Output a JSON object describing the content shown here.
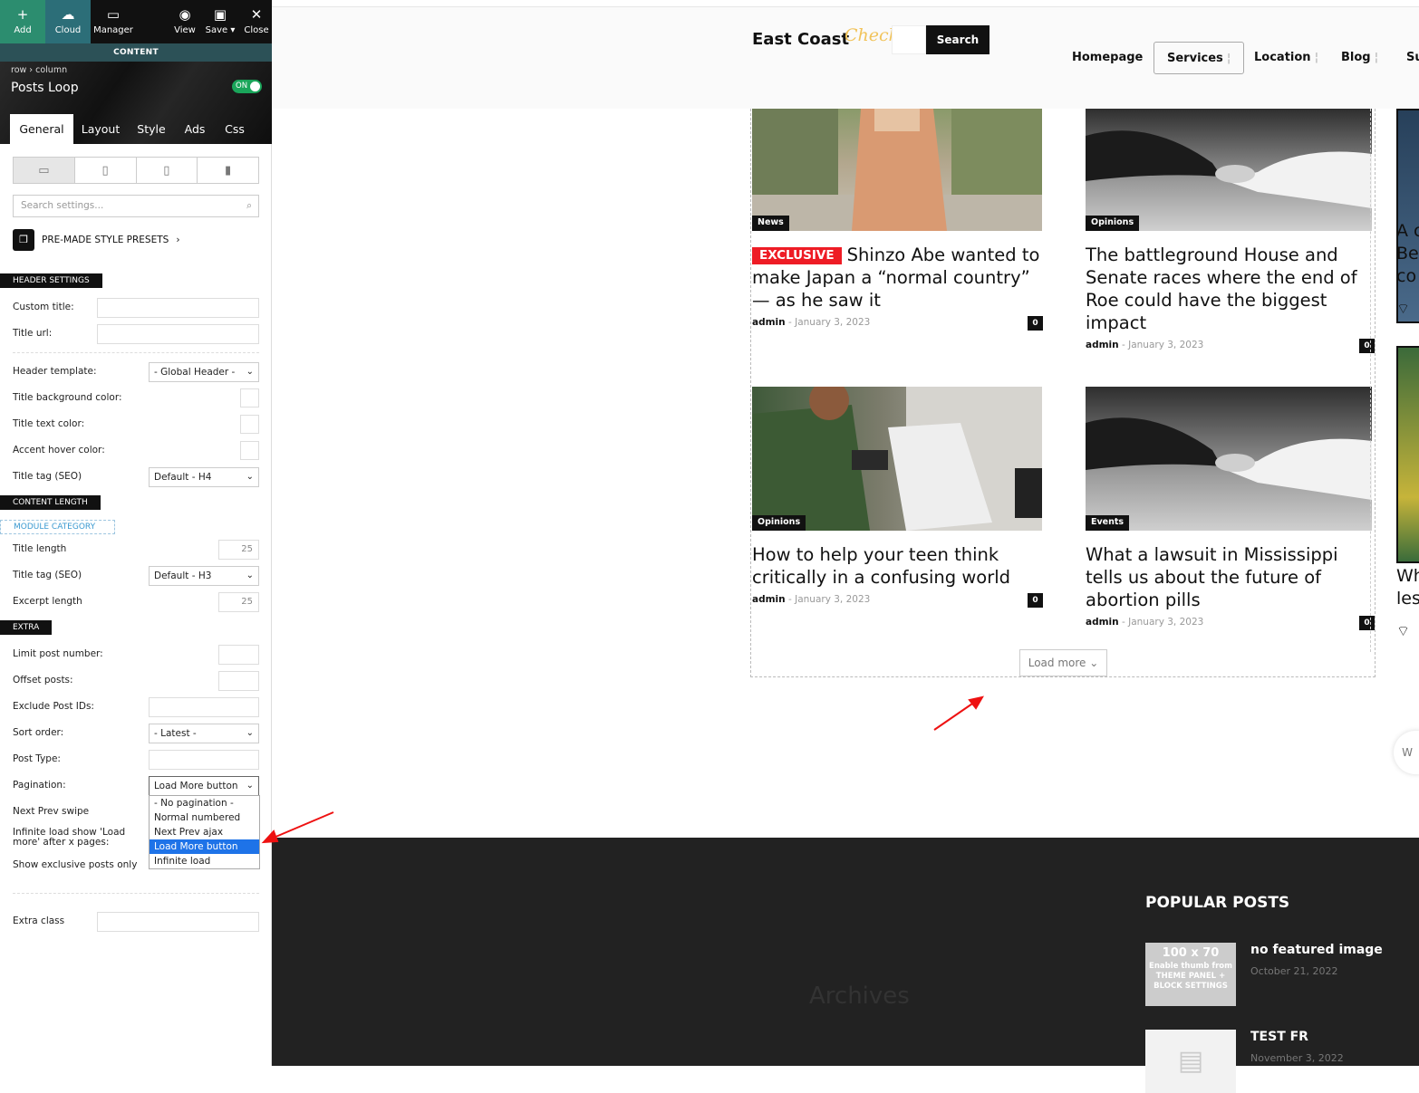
{
  "toolbar": {
    "add": "Add",
    "cloud": "Cloud",
    "manager": "Manager",
    "view": "View",
    "save": "Save",
    "close": "Close",
    "content_label": "CONTENT"
  },
  "panel": {
    "breadcrumb": "row › column",
    "title": "Posts Loop",
    "toggle": "ON",
    "tabs": [
      "General",
      "Layout",
      "Style",
      "Ads",
      "Css"
    ],
    "search_placeholder": "Search settings...",
    "presets": "PRE-MADE STYLE PRESETS",
    "sections": {
      "header": "HEADER SETTINGS",
      "content_length": "CONTENT LENGTH",
      "module_category": "MODULE CATEGORY",
      "extra": "EXTRA"
    },
    "labels": {
      "custom_title": "Custom title:",
      "title_url": "Title url:",
      "header_template": "Header template:",
      "title_bg": "Title background color:",
      "title_text": "Title text color:",
      "accent_hover": "Accent hover color:",
      "title_tag_h4": "Title tag (SEO)",
      "title_length": "Title length",
      "title_tag_h3": "Title tag (SEO)",
      "excerpt_length": "Excerpt length",
      "limit_post": "Limit post number:",
      "offset": "Offset posts:",
      "exclude": "Exclude Post IDs:",
      "sort_order": "Sort order:",
      "post_type": "Post Type:",
      "pagination": "Pagination:",
      "next_prev_swipe": "Next Prev swipe",
      "infinite_load": "Infinite load show 'Load more' after x pages:",
      "exclusive": "Show exclusive posts only",
      "extra_class": "Extra class"
    },
    "values": {
      "header_template": "- Global Header -",
      "title_tag_h4": "Default - H4",
      "title_length": "25",
      "title_tag_h3": "Default - H3",
      "excerpt_length": "25",
      "sort_order": "- Latest -",
      "pagination": "Load More button"
    },
    "pagination_options": [
      "- No pagination -",
      "Normal numbered",
      "Next Prev ajax",
      "Load More button",
      "Infinite load"
    ],
    "pagination_selected_index": 3
  },
  "site": {
    "logo": "East Coast",
    "logo_script": "Check",
    "search_button": "Search",
    "nav": [
      "Homepage",
      "Services",
      "Location",
      "Blog",
      "Su"
    ]
  },
  "posts": [
    {
      "category": "News",
      "badge": "EXCLUSIVE",
      "title": "Shinzo Abe wanted to make Japan a “normal country” — as he saw it",
      "author": "admin",
      "date": "January 3, 2023",
      "comments": "0"
    },
    {
      "category": "Opinions",
      "title": "The battleground House and Senate races where the end of Roe could have the biggest impact",
      "author": "admin",
      "date": "January 3, 2023",
      "comments": "0"
    },
    {
      "category": "Opinions",
      "title": "How to help your teen think critically in a confusing world",
      "author": "admin",
      "date": "January 3, 2023",
      "comments": "0"
    },
    {
      "category": "Events",
      "title": "What a lawsuit in Mississippi tells us about the future of abortion pills",
      "author": "admin",
      "date": "January 3, 2023",
      "comments": "0"
    }
  ],
  "meta_sep": "-",
  "load_more": "Load more",
  "side_fragments": {
    "a1": "A c",
    "a2": "Be",
    "a3": "co",
    "b1": "Wh",
    "b2": "les",
    "float": "W"
  },
  "footer": {
    "archives": "Archives",
    "popular_title": "POPULAR POSTS",
    "popular": [
      {
        "title": "no featured image",
        "date": "October 21, 2022",
        "thumb_size": "100 x 70",
        "thumb_text": "Enable thumb from THEME PANEL + BLOCK SETTINGS"
      },
      {
        "title": "TEST FR",
        "date": "November 3, 2022"
      }
    ]
  },
  "colors": {
    "accent": "#2c8d6f",
    "exclusive": "#ee1c25",
    "dropdown_highlight": "#1e73e8"
  }
}
